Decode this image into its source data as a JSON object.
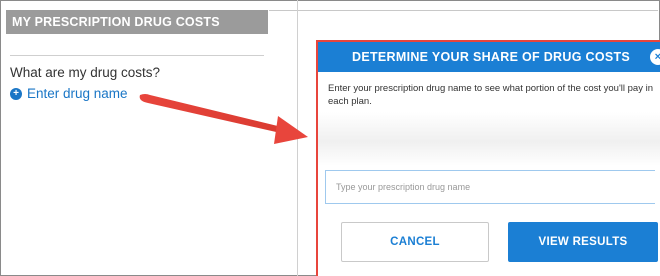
{
  "left_panel": {
    "header": "MY PRESCRIPTION DRUG COSTS",
    "question": "What are my drug costs?",
    "link_icon": "plus-circle-icon",
    "link_text": "Enter drug name"
  },
  "modal": {
    "title": "DETERMINE YOUR SHARE OF DRUG COSTS",
    "close_icon": "close-icon",
    "description": "Enter your prescription drug name to see what portion of the cost you'll pay in each plan.",
    "input_value": "",
    "input_placeholder": "Type your prescription drug name",
    "cancel_label": "CANCEL",
    "view_results_label": "VIEW RESULTS"
  },
  "colors": {
    "accent_blue": "#1b7fd4",
    "annotation_red": "#e8453c",
    "header_gray": "#9b9b9b"
  }
}
